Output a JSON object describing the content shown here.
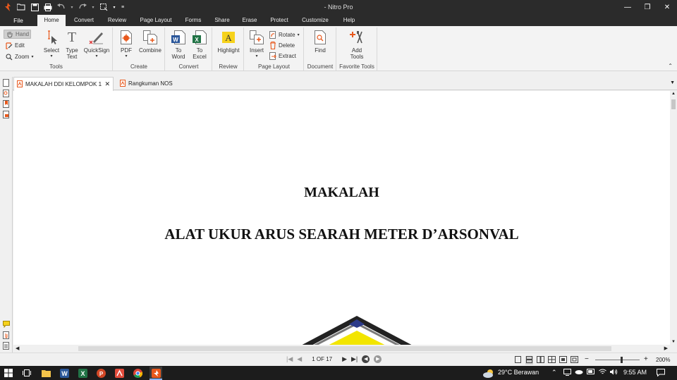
{
  "app": {
    "title": "- Nitro Pro"
  },
  "menu": {
    "file": "File",
    "tabs": [
      "Home",
      "Convert",
      "Review",
      "Page Layout",
      "Forms",
      "Share",
      "Erase",
      "Protect",
      "Customize",
      "Help"
    ],
    "active_tab": "Home"
  },
  "ribbon": {
    "tools": {
      "label": "Tools",
      "hand": "Hand",
      "edit": "Edit",
      "zoom": "Zoom",
      "select": "Select",
      "type_text": "Type\nText",
      "quicksign": "QuickSign"
    },
    "create": {
      "label": "Create",
      "pdf": "PDF",
      "combine": "Combine"
    },
    "convert": {
      "label": "Convert",
      "to_word": "To\nWord",
      "to_excel": "To\nExcel"
    },
    "review": {
      "label": "Review",
      "highlight": "Highlight"
    },
    "page_layout": {
      "label": "Page Layout",
      "insert": "Insert",
      "rotate": "Rotate",
      "delete": "Delete",
      "extract": "Extract"
    },
    "document": {
      "label": "Document",
      "find": "Find"
    },
    "favorite": {
      "label": "Favorite Tools",
      "add_tools": "Add\nTools"
    }
  },
  "tabs": [
    {
      "label": "MAKALAH DDI KELOMPOK 1",
      "active": true
    },
    {
      "label": "Rangkuman NOS",
      "active": false
    }
  ],
  "document": {
    "title": "MAKALAH",
    "subtitle": "ALAT UKUR ARUS SEARAH METER D’ARSONVAL"
  },
  "status": {
    "page_indicator": "1 OF 17",
    "zoom_level": "200%"
  },
  "taskbar": {
    "weather": "29°C  Berawan",
    "time": "9:55 AM"
  },
  "colors": {
    "titlebar": "#2b2b2b",
    "ribbon": "#f3f3f3",
    "accent_orange": "#e8581c",
    "word_blue": "#2b579a",
    "excel_green": "#217346",
    "highlight_yellow": "#f6d21b"
  }
}
